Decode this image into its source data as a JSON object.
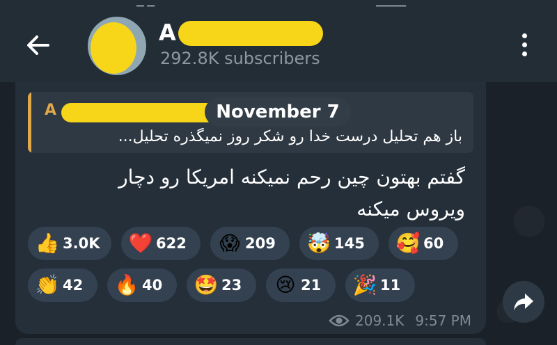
{
  "header": {
    "back_icon": "arrow-left-icon",
    "channel_initial": "A",
    "subscribers": "292.8K subscribers",
    "menu_icon": "more-vertical-icon"
  },
  "date_pill": "November 7",
  "reply": {
    "author_initial": "A",
    "text": "باز هم تحلیل درست خدا رو شکر روز نمیگذره  تحلیل..."
  },
  "message": {
    "line1": "گفتم بهتون چین رحم نمیکنه امریکا رو دچار",
    "line2": "ویروس میکنه"
  },
  "reactions": [
    {
      "emoji": "👍",
      "count": "3.0K",
      "icon": "thumbs-up-icon"
    },
    {
      "emoji": "❤️",
      "count": "622",
      "icon": "heart-icon"
    },
    {
      "emoji": "😱",
      "count": "209",
      "icon": "screaming-face-icon"
    },
    {
      "emoji": "🤯",
      "count": "145",
      "icon": "exploding-head-icon"
    },
    {
      "emoji": "🥰",
      "count": "60",
      "icon": "smiling-hearts-icon"
    },
    {
      "emoji": "👏",
      "count": "42",
      "icon": "clapping-hands-icon"
    },
    {
      "emoji": "🔥",
      "count": "40",
      "icon": "fire-icon"
    },
    {
      "emoji": "🤩",
      "count": "23",
      "icon": "star-struck-icon"
    },
    {
      "emoji": "😢",
      "count": "21",
      "icon": "crying-face-icon"
    },
    {
      "emoji": "🎉",
      "count": "11",
      "icon": "party-popper-icon"
    }
  ],
  "meta": {
    "views": "209.1K",
    "time": "9:57 PM",
    "views_icon": "eye-icon"
  },
  "share_icon": "share-forward-icon",
  "colors": {
    "header_bg": "#232d36",
    "bubble_bg": "#252f39",
    "accent_orange": "#e1a74b",
    "redaction_yellow": "#f7d61a",
    "reaction_bg": "#334150"
  }
}
